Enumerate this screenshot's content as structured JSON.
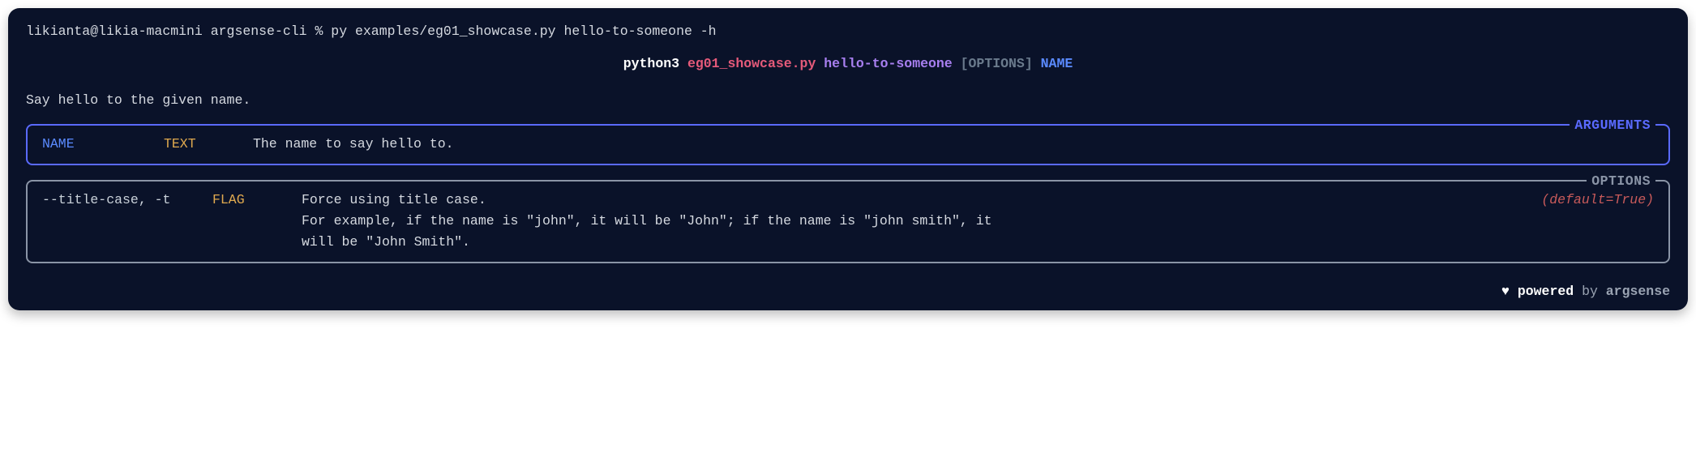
{
  "prompt": {
    "user_host": "likianta@likia-macmini",
    "cwd": "argsense-cli",
    "symbol": "%",
    "command": "py examples/eg01_showcase.py hello-to-someone -h"
  },
  "usage": {
    "python": "python3",
    "script": "eg01_showcase.py",
    "subcommand": "hello-to-someone",
    "options_token": "[OPTIONS]",
    "positional": "NAME"
  },
  "description": "Say hello to the given name.",
  "arguments": {
    "title": "ARGUMENTS",
    "rows": [
      {
        "name": "NAME",
        "type": "TEXT",
        "desc": "The name to say hello to."
      }
    ]
  },
  "options": {
    "title": "OPTIONS",
    "rows": [
      {
        "flags": "--title-case, -t",
        "type": "FLAG",
        "desc": "Force using title case.\nFor example, if the name is \"john\", it will be \"John\"; if the name is \"john smith\", it\nwill be \"John Smith\".",
        "default": "(default=True)"
      }
    ]
  },
  "footer": {
    "heart": "♥",
    "powered": "powered",
    "by": "by",
    "brand": "argsense"
  }
}
